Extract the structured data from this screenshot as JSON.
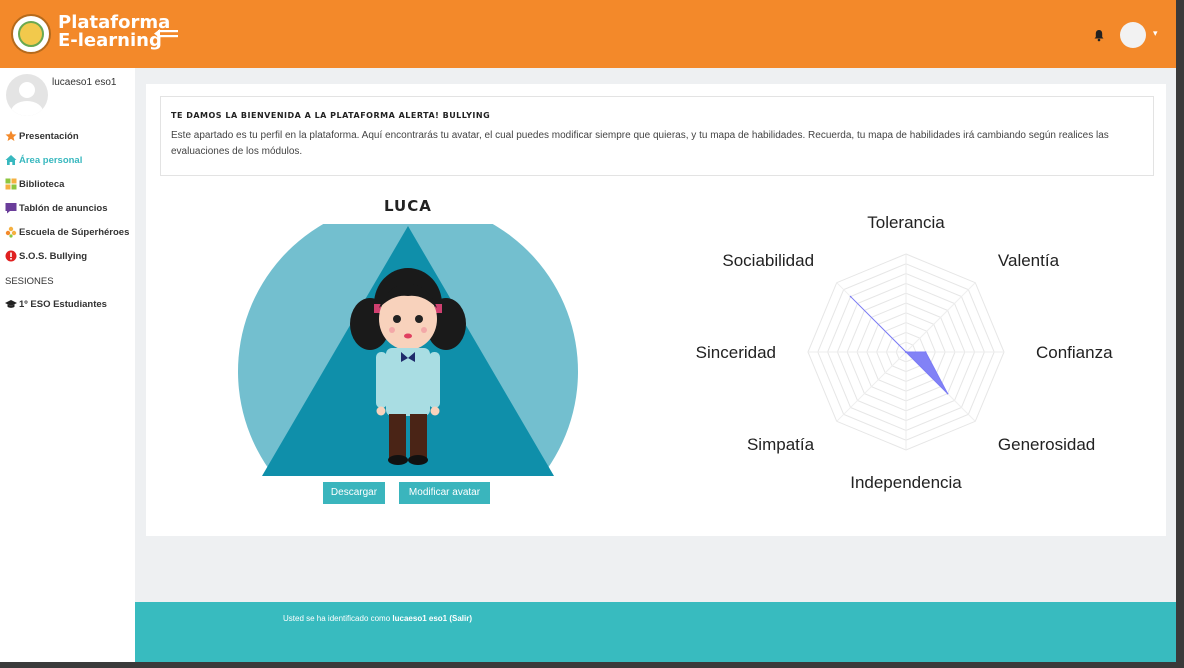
{
  "header": {
    "brand_line1": "Plataforma",
    "brand_line2": "E-learning",
    "colors": {
      "bar": "#f3892a",
      "accent": "#3ab5bd"
    }
  },
  "sidebar": {
    "username": "lucaeso1 eso1",
    "items": [
      {
        "label": "Presentación",
        "icon": "star-icon",
        "color": "#f3892a"
      },
      {
        "label": "Área personal",
        "icon": "home-icon",
        "color": "#38b8bf",
        "active": true
      },
      {
        "label": "Biblioteca",
        "icon": "library-icon",
        "color": "#8dc63f"
      },
      {
        "label": "Tablón de anuncios",
        "icon": "board-icon",
        "color": "#6a3d9a"
      },
      {
        "label": "Escuela de Súperhéroes",
        "icon": "puzzle-icon",
        "color": "#f5b041"
      },
      {
        "label": "S.O.S. Bullying",
        "icon": "alert-icon",
        "color": "#e02020"
      }
    ],
    "section_title": "SESIONES",
    "session_item": {
      "label": "1º ESO Estudiantes",
      "icon": "graduation-cap-icon"
    }
  },
  "welcome": {
    "title": "TE DAMOS LA BIENVENIDA A LA PLATAFORMA ALERTA! BULLYING",
    "text": "Este apartado es tu perfil en la plataforma. Aquí encontrarás tu avatar, el cual puedes modificar siempre que quieras, y tu mapa de habilidades. Recuerda, tu mapa de habilidades irá cambiando según realices las evaluaciones de los módulos."
  },
  "avatar": {
    "name": "LUCA",
    "download_label": "Descargar",
    "modify_label": "Modificar avatar"
  },
  "chart_data": {
    "type": "radar",
    "categories": [
      "Tolerancia",
      "Valentía",
      "Confianza",
      "Generosidad",
      "Independencia",
      "Simpatía",
      "Sinceridad",
      "Sociabilidad"
    ],
    "series": [
      {
        "values": [
          0,
          0,
          2,
          6,
          0,
          0,
          0,
          8
        ],
        "color": "#7b7bf5"
      }
    ],
    "rmax": 10,
    "grid": true
  },
  "footer": {
    "prefix": "Usted se ha identificado como",
    "user": "lucaeso1 eso1",
    "logout": "(Salir)"
  }
}
